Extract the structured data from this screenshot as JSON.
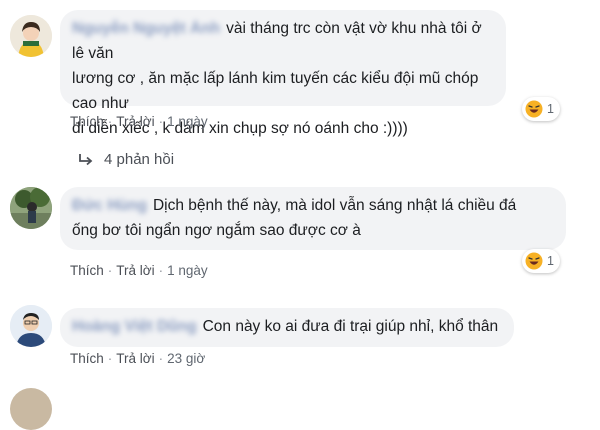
{
  "comments": [
    {
      "text_line1": "vài tháng trc còn vật vờ khu nhà tôi ở lê văn",
      "text_line2": "lương cơ , ăn mặc lấp lánh kim tuyến các kiểu đội mũ chóp cao như",
      "text_line3": "đi diễn xiếc , k dám xin chụp sợ nó oánh cho :))))",
      "like": "Thích",
      "reply": "Trả lời",
      "time": "1 ngày",
      "reaction_count": "1",
      "reaction_icon": "haha-icon"
    },
    {
      "text_line1": "Dịch bệnh thế này, mà idol vẫn sáng nhật lá chiều đá",
      "text_line2": "ống bơ tôi ngẩn ngơ ngắm sao được cơ à",
      "like": "Thích",
      "reply": "Trả lời",
      "time": "1 ngày",
      "reaction_count": "1",
      "reaction_icon": "haha-icon"
    },
    {
      "text_line1": "Con này ko ai đưa đi trại giúp nhỉ, khổ thân",
      "like": "Thích",
      "reply": "Trả lời",
      "time": "23 giờ"
    }
  ],
  "replies_link": "4 phản hồi",
  "colors": {
    "bubble": "#f2f3f5",
    "link": "#385898",
    "meta": "#606770",
    "haha": "#f7b125"
  }
}
